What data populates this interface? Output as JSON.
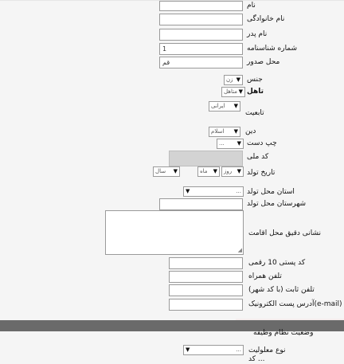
{
  "form": {
    "first_name": {
      "label": "نام",
      "value": ""
    },
    "last_name": {
      "label": "نام خانوادگی",
      "value": ""
    },
    "father_name": {
      "label": "نام پدر",
      "value": ""
    },
    "id_number": {
      "label": "شماره شناسنامه",
      "value": "1"
    },
    "issue_place": {
      "label": "محل صدور",
      "value": "قم"
    },
    "gender": {
      "label": "جنس",
      "selected": "زن"
    },
    "marital": {
      "label": "تاهل",
      "selected": "متاهل"
    },
    "nationality": {
      "label": "تابعیت",
      "selected": "ایرانی"
    },
    "religion": {
      "label": "دین",
      "selected": "اسلام"
    },
    "handedness": {
      "label": "چپ دست",
      "selected": "..."
    },
    "national_code": {
      "label": "کد ملی",
      "value": ""
    },
    "birth_date": {
      "label": "تاریخ تولد",
      "day": "روز",
      "month": "ماه",
      "year": "سال"
    },
    "birth_province": {
      "label": "استان محل تولد",
      "selected": "..."
    },
    "birth_city": {
      "label": "شهرستان محل تولد",
      "value": ""
    },
    "address": {
      "label": "نشانی دقیق محل اقامت",
      "value": ""
    },
    "postal_code": {
      "label": "کد پستی 10 رقمی",
      "value": ""
    },
    "mobile": {
      "label": "تلفن همراه",
      "value": ""
    },
    "phone": {
      "label": "تلفن ثابت (با کد شهر)",
      "value": ""
    },
    "email": {
      "label": "آدرس پست الکترونیک(e-mail)",
      "value": ""
    },
    "military_status": {
      "label": "وضعیت نظام وظیفه"
    },
    "disability_type": {
      "label": "نوع معلولیت",
      "selected": "..."
    },
    "cut_off": {
      "label": "کد ..."
    }
  }
}
